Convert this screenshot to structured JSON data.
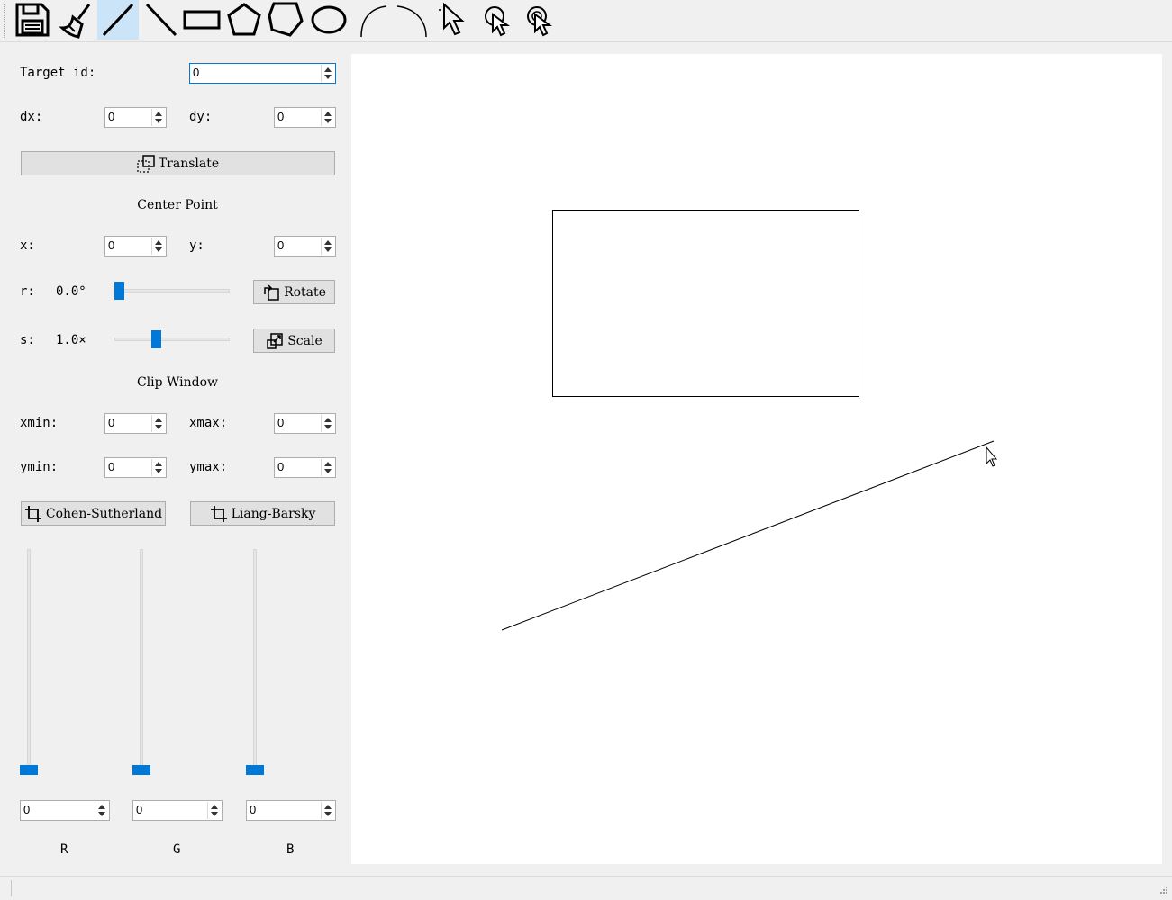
{
  "toolbar": {
    "tools": [
      {
        "name": "save-icon"
      },
      {
        "name": "clear-broom-icon"
      },
      {
        "name": "line-dda-icon",
        "active": true
      },
      {
        "name": "line-bresenham-icon"
      },
      {
        "name": "rectangle-icon"
      },
      {
        "name": "pentagon-icon"
      },
      {
        "name": "polygon-icon"
      },
      {
        "name": "ellipse-icon"
      },
      {
        "name": "curve-bezier-icon"
      },
      {
        "name": "curve-bspline-icon"
      },
      {
        "name": "select-cursor-icon"
      },
      {
        "name": "select-cursor-2-icon"
      },
      {
        "name": "select-cursor-3-icon"
      }
    ]
  },
  "panel": {
    "target_id_label": "Target id:",
    "target_id_value": "0",
    "dx_label": "dx:",
    "dx_value": "0",
    "dy_label": "dy:",
    "dy_value": "0",
    "translate_label": "Translate",
    "center_point_label": "Center Point",
    "x_label": "x:",
    "x_value": "0",
    "y_label": "y:",
    "y_value": "0",
    "r_label": "r:",
    "r_value": "0.0°",
    "r_slider_fraction": 0.0,
    "rotate_label": "Rotate",
    "s_label": "s:",
    "s_value": "1.0×",
    "s_slider_fraction": 0.35,
    "scale_label": "Scale",
    "clip_window_label": "Clip Window",
    "xmin_label": "xmin:",
    "xmin_value": "0",
    "xmax_label": "xmax:",
    "xmax_value": "0",
    "ymin_label": "ymin:",
    "ymin_value": "0",
    "ymax_label": "ymax:",
    "ymax_value": "0",
    "cohen_label": "Cohen-Sutherland",
    "liang_label": "Liang-Barsky",
    "color": {
      "r_label": "R",
      "r_value": "0",
      "g_label": "G",
      "g_value": "0",
      "b_label": "B",
      "b_value": "0"
    }
  },
  "colors": {
    "accent": "#0078d7",
    "canvas": "#ffffff",
    "window": "#f0f0f0"
  }
}
